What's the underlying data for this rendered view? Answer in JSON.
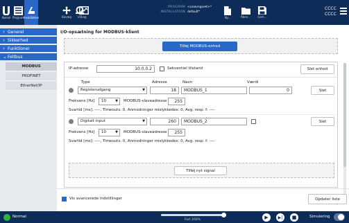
{
  "topbar": {
    "tabs": [
      {
        "label": "Kørsel",
        "icon": "robot-logo-icon"
      },
      {
        "label": "Program",
        "icon": "program-list-icon"
      },
      {
        "label": "Installation",
        "icon": "installation-icon"
      },
      {
        "label": "Bevæg",
        "icon": "move-cross-icon"
      },
      {
        "label": "I/O",
        "icon": "io-icon"
      },
      {
        "label": "Log",
        "icon": "log-chart-icon"
      }
    ],
    "program_key": "PROGRAM",
    "program_value": "<unavngivet>*",
    "installation_key": "INSTALLATION",
    "installation_value": "default*",
    "file_buttons": [
      "Ny...",
      "Åben...",
      "Gem..."
    ],
    "right_top": "CCCC",
    "right_bottom": "CCCC"
  },
  "leftnav": {
    "items": [
      {
        "label": "Generel"
      },
      {
        "label": "Sikkerhed"
      },
      {
        "label": "Funktioner"
      },
      {
        "label": "Feltbus",
        "expanded": true
      }
    ],
    "subitems": [
      {
        "label": "MODBUS",
        "active": true
      },
      {
        "label": "PROFINET"
      },
      {
        "label": "EtherNet/IP"
      }
    ]
  },
  "main": {
    "title": "I/O-opsætning for MODBUS-klient",
    "add_device_label": "Tilføj MODBUS-enhed",
    "ip_label": "IP-adresse",
    "ip_value": "10.0.0.2",
    "sequential_label": "Sekventiel tilstand",
    "delete_device_label": "Slet enhed",
    "headers": {
      "type": "Type",
      "address": "Adresse",
      "name": "Navn",
      "value": "Værdi"
    },
    "signals": [
      {
        "type": "Registerudgang",
        "address": "18",
        "name": "MODBUS_1",
        "value": "0",
        "freq_label": "Frekvens [Hz]",
        "freq": "10",
        "slave_label": "MODBUS-slaveadresse",
        "slave": "255",
        "stats": "Svartid [ms]: ----,  Timeouts:  0,  Anmodninger mislykkedes:  0,  Avg. resp. f: ----",
        "delete_label": "Slet"
      },
      {
        "type": "Digitalt input",
        "address": "260",
        "name": "MODBUS_2",
        "value": "",
        "freq_label": "Frekvens [Hz]",
        "freq": "10",
        "slave_label": "MODBUS-slaveadresse",
        "slave": "255",
        "stats": "Svartid [ms]: ----,  Timeouts:  0,  Anmodninger mislykkedes:  0,  Avg. resp. f: ----",
        "delete_label": "Slet"
      }
    ],
    "add_signal_label": "Tilføj nyt signal",
    "advanced_label": "Vis avancerede indstillinger",
    "refresh_label": "Opdater liste"
  },
  "bottombar": {
    "status": "Normal",
    "speed_label": "Fart 100%",
    "speed_fraction": 1.0,
    "sim_label": "Simulering",
    "colors": {
      "status": "#2bb43f",
      "bar": "#0e2c58",
      "accent": "#2a68c8"
    }
  }
}
